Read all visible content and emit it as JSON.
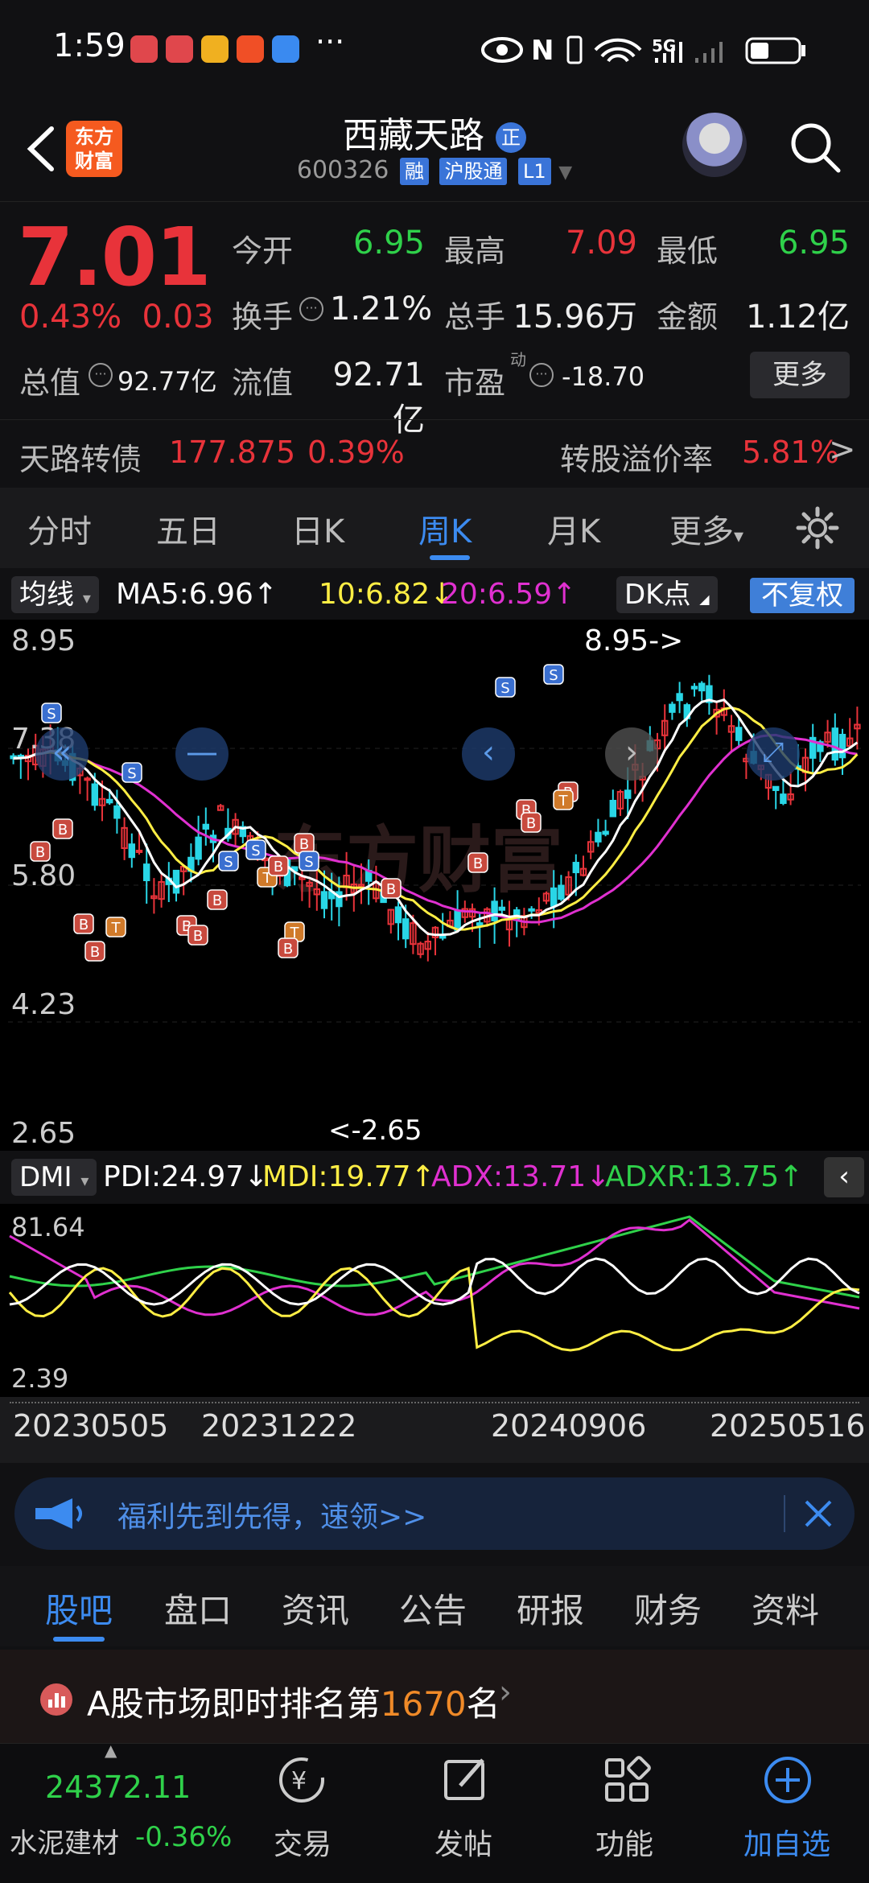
{
  "status": {
    "time": "1:59",
    "more": "···",
    "network": "5G"
  },
  "header": {
    "logo_line1": "东方",
    "logo_line2": "财富",
    "title": "西藏天路",
    "title_badge": "正",
    "code": "600326",
    "tag1": "融",
    "tag2": "沪股通",
    "tag3": "L1"
  },
  "quote": {
    "price": "7.01",
    "change_pct": "0.43%",
    "change_abs": "0.03",
    "open_label": "今开",
    "open": "6.95",
    "high_label": "最高",
    "high": "7.09",
    "low_label": "最低",
    "low": "6.95",
    "turnover_label": "换手",
    "turnover": "1.21%",
    "volume_label": "总手",
    "volume": "15.96万",
    "amount_label": "金额",
    "amount": "1.12亿",
    "mktcap_label": "总值",
    "mktcap": "92.77亿",
    "float_label": "流值",
    "float": "92.71亿",
    "pe_label": "市盈",
    "pe_sup": "动",
    "pe": "-18.70",
    "more_label": "更多"
  },
  "bond": {
    "name": "天路转债",
    "price": "177.875",
    "pct": "0.39%",
    "premium_label": "转股溢价率",
    "premium": "5.81%"
  },
  "period_tabs": [
    "分时",
    "五日",
    "日K",
    "周K",
    "月K",
    "更多"
  ],
  "ma_row": {
    "selector": "均线",
    "ma5": "MA5:6.96↑",
    "ma10": "10:6.82↓",
    "ma20": "20:6.59↑",
    "dk": "DK点",
    "adjust": "不复权"
  },
  "kchart": {
    "y_labels": [
      "8.95",
      "7.38",
      "5.80",
      "4.23",
      "2.65"
    ],
    "max_marker": "8.95->",
    "min_marker": "<-2.65",
    "watermark": "东方财富"
  },
  "dmi": {
    "selector": "DMI",
    "pdi": "PDI:24.97↓",
    "mdi": "MDI:19.77↑",
    "adx": "ADX:13.71↓",
    "adxr": "ADXR:13.75↑",
    "y_top": "81.64",
    "y_bottom": "2.39"
  },
  "dates": [
    "20230505",
    "20231222",
    "20240906",
    "20250516"
  ],
  "promo": {
    "text": "福利先到先得，速领>>"
  },
  "section_tabs": [
    "股吧",
    "盘口",
    "资讯",
    "公告",
    "研报",
    "财务",
    "资料"
  ],
  "rank": {
    "prefix": "A股市场即时排名第",
    "number": "1670",
    "suffix": "名"
  },
  "bottom": {
    "index_value": "24372.11",
    "index_name": "水泥建材",
    "index_pct": "-0.36%",
    "trade": "交易",
    "post": "发帖",
    "func": "功能",
    "add": "加自选"
  },
  "colors": {
    "up": "#e8333a",
    "down": "#2fd14a",
    "accent": "#3c8bf0",
    "ma5": "#ffffff",
    "ma10": "#ffee44",
    "ma20": "#e030d0"
  }
}
